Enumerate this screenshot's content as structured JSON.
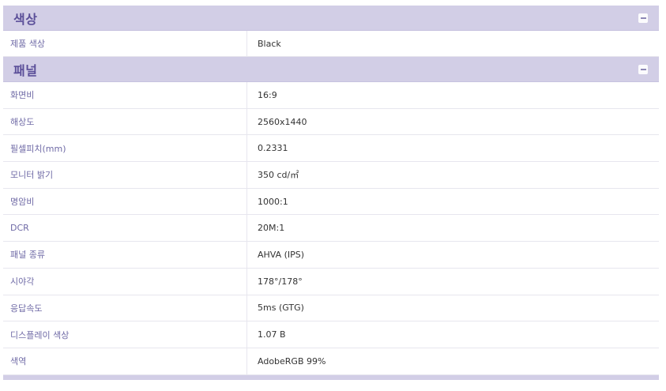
{
  "sections": [
    {
      "title": "색상",
      "rows": [
        {
          "label": "제품 색상",
          "value": "Black"
        }
      ]
    },
    {
      "title": "패널",
      "rows": [
        {
          "label": "화면비",
          "value": "16:9"
        },
        {
          "label": "해상도",
          "value": "2560x1440"
        },
        {
          "label": "필셀피치(mm)",
          "value": "0.2331"
        },
        {
          "label": "모니터 밝기",
          "value": "350 cd/㎡"
        },
        {
          "label": "명암비",
          "value": "1000:1"
        },
        {
          "label": "DCR",
          "value": "20M:1"
        },
        {
          "label": "패널 종류",
          "value": "AHVA (IPS)"
        },
        {
          "label": "시야각",
          "value": "178°/178°"
        },
        {
          "label": "응답속도",
          "value": "5ms (GTG)"
        },
        {
          "label": "디스플레이 색상",
          "value": "1.07 B"
        },
        {
          "label": "색역",
          "value": "AdobeRGB 99%"
        }
      ]
    }
  ],
  "colors": {
    "header_bg": "#d2cee6",
    "header_text": "#5b4f99",
    "label_text": "#6f6aa6",
    "value_text": "#333333"
  },
  "icons": {
    "collapse": "minus-icon"
  }
}
